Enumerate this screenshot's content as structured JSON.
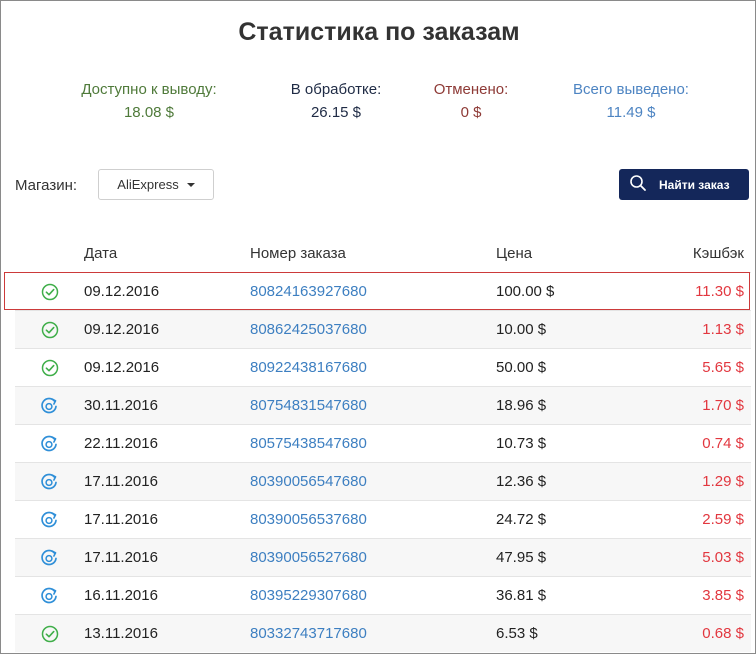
{
  "title": "Статистика по заказам",
  "stats": {
    "available": {
      "label": "Доступно к выводу:",
      "value": "18.08 $"
    },
    "processing": {
      "label": "В обработке:",
      "value": "26.15 $"
    },
    "cancelled": {
      "label": "Отменено:",
      "value": "0 $"
    },
    "withdrawn": {
      "label": "Всего выведено:",
      "value": "11.49 $"
    }
  },
  "filter": {
    "store_label": "Магазин:",
    "store_selected": "AliExpress",
    "search_button": "Найти заказ"
  },
  "table": {
    "headers": {
      "date": "Дата",
      "order": "Номер заказа",
      "price": "Цена",
      "cashback": "Кэшбэк"
    },
    "rows": [
      {
        "status": "check-circle-icon",
        "date": "09.12.2016",
        "order": "80824163927680",
        "price": "100.00 $",
        "cashback": "11.30 $"
      },
      {
        "status": "check-circle-icon",
        "date": "09.12.2016",
        "order": "80862425037680",
        "price": "10.00 $",
        "cashback": "1.13 $"
      },
      {
        "status": "check-circle-icon",
        "date": "09.12.2016",
        "order": "80922438167680",
        "price": "50.00 $",
        "cashback": "5.65 $"
      },
      {
        "status": "processing-icon",
        "date": "30.11.2016",
        "order": "80754831547680",
        "price": "18.96 $",
        "cashback": "1.70 $"
      },
      {
        "status": "processing-icon",
        "date": "22.11.2016",
        "order": "80575438547680",
        "price": "10.73 $",
        "cashback": "0.74 $"
      },
      {
        "status": "processing-icon",
        "date": "17.11.2016",
        "order": "80390056547680",
        "price": "12.36 $",
        "cashback": "1.29 $"
      },
      {
        "status": "processing-icon",
        "date": "17.11.2016",
        "order": "80390056537680",
        "price": "24.72 $",
        "cashback": "2.59 $"
      },
      {
        "status": "processing-icon",
        "date": "17.11.2016",
        "order": "80390056527680",
        "price": "47.95 $",
        "cashback": "5.03 $"
      },
      {
        "status": "processing-icon",
        "date": "16.11.2016",
        "order": "80395229307680",
        "price": "36.81 $",
        "cashback": "3.85 $"
      },
      {
        "status": "check-circle-icon",
        "date": "13.11.2016",
        "order": "80332743717680",
        "price": "6.53 $",
        "cashback": "0.68 $"
      }
    ]
  },
  "colors": {
    "available": "#4f7a3a",
    "processing": "#1f2b45",
    "cancelled": "#8e3a36",
    "withdrawn": "#4d84c2",
    "link": "#3d7fc1",
    "cashback": "#e2373f",
    "button": "#14275a",
    "check_icon": "#3fae49",
    "processing_icon": "#2f8fd8"
  }
}
